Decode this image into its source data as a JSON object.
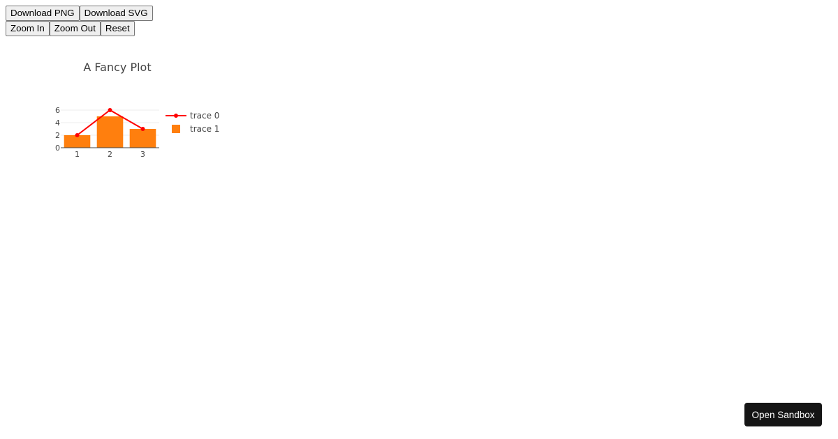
{
  "toolbar": {
    "download_png": "Download PNG",
    "download_svg": "Download SVG",
    "zoom_in": "Zoom In",
    "zoom_out": "Zoom Out",
    "reset": "Reset"
  },
  "sandbox": {
    "label": "Open Sandbox"
  },
  "chart_data": {
    "type": "bar",
    "title": "A Fancy Plot",
    "xlabel": "",
    "ylabel": "",
    "categories": [
      1,
      2,
      3
    ],
    "ylim": [
      0,
      6
    ],
    "yticks": [
      0,
      2,
      4,
      6
    ],
    "grid": true,
    "legend_position": "right",
    "series": [
      {
        "name": "trace 0",
        "type": "line",
        "color": "#ff0000",
        "x": [
          1,
          2,
          3
        ],
        "values": [
          2,
          6,
          3
        ]
      },
      {
        "name": "trace 1",
        "type": "bar",
        "color": "#ff7f0e",
        "x": [
          1,
          2,
          3
        ],
        "values": [
          2,
          5,
          3
        ]
      }
    ]
  }
}
